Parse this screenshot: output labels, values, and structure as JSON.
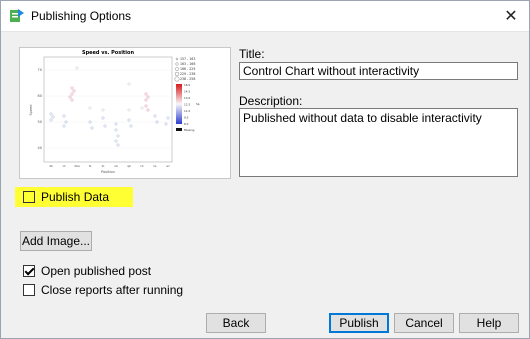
{
  "window": {
    "title": "Publishing Options",
    "close_glyph": "✕"
  },
  "preview": {
    "chart_title": "Speed vs. Position",
    "y_label": "Speed",
    "x_label": "Position",
    "legend_items": [
      "157 - 163",
      "163 - 166",
      "166 - 229",
      "229 - 238",
      "238 - 258"
    ],
    "scale_values": [
      "16.0",
      "14.5",
      "13.0",
      "12.5",
      "11.0",
      "9.5",
      "8.0"
    ],
    "scale_label": "Sp",
    "missing_label": "Missing",
    "y_ticks": [
      "70",
      "60",
      "50",
      "40"
    ],
    "x_ticks": [
      "db",
      "ot",
      "dbe",
      "fs",
      "lb",
      "ob",
      "qb",
      "rb",
      "te",
      "wr"
    ]
  },
  "fields": {
    "title_label": "Title:",
    "title_value": "Control Chart without interactivity",
    "description_label": "Description:",
    "description_value": "Published without data to disable interactivity"
  },
  "options": {
    "publish_data_label": "Publish Data",
    "publish_data_checked": false,
    "add_image_label": "Add Image...",
    "open_published_label": "Open published post",
    "open_published_checked": true,
    "close_reports_label": "Close reports after running",
    "close_reports_checked": false
  },
  "buttons": {
    "back": "Back",
    "publish": "Publish",
    "cancel": "Cancel",
    "help": "Help"
  },
  "colors": {
    "highlight": "#ffff33",
    "default_button_border": "#0078d7"
  }
}
